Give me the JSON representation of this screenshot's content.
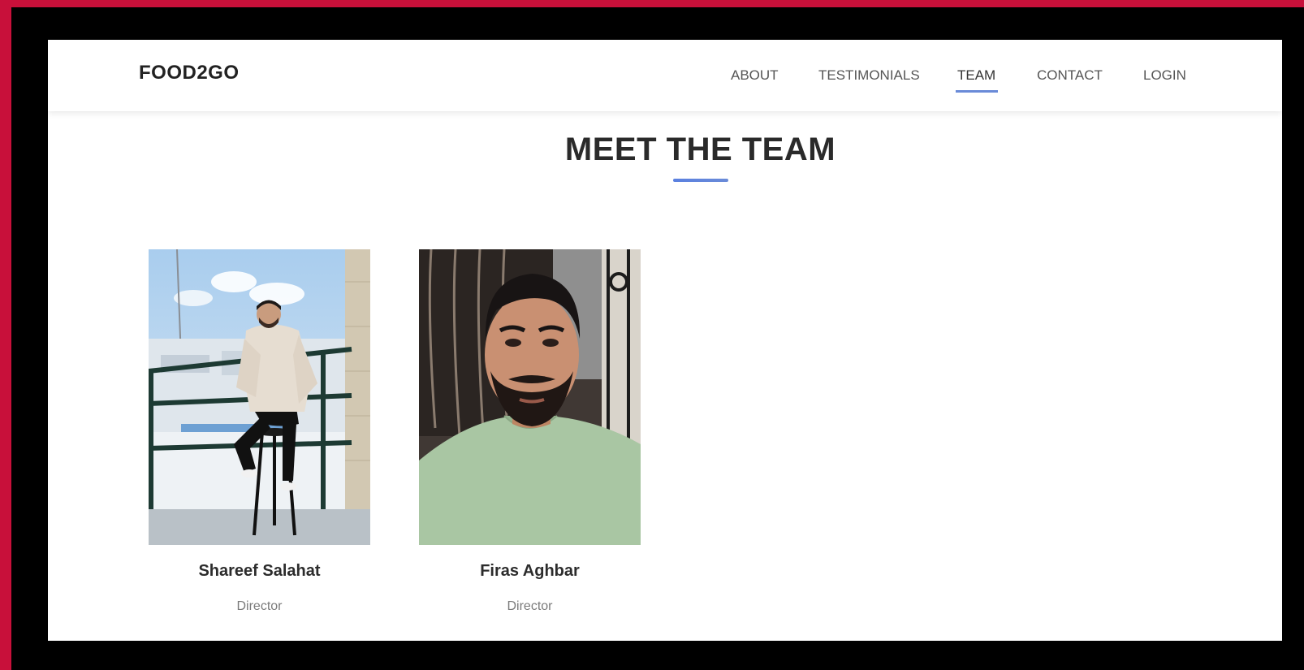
{
  "navbar": {
    "brand": "FOOD2GO",
    "items": [
      {
        "label": "ABOUT"
      },
      {
        "label": "TESTIMONIALS"
      },
      {
        "label": "TEAM"
      },
      {
        "label": "CONTACT"
      },
      {
        "label": "LOGIN"
      }
    ],
    "active_item": "TEAM",
    "active_color": "#6a8bd8"
  },
  "team_section": {
    "title": "MEET THE TEAM",
    "members": [
      {
        "name": "Shareef Salahat",
        "role": "Director"
      },
      {
        "name": "Firas Aghbar",
        "role": "Director"
      }
    ]
  },
  "colors": {
    "outer_border": "#c8103a",
    "frame": "#000000",
    "accent": "#6a8bd8"
  }
}
